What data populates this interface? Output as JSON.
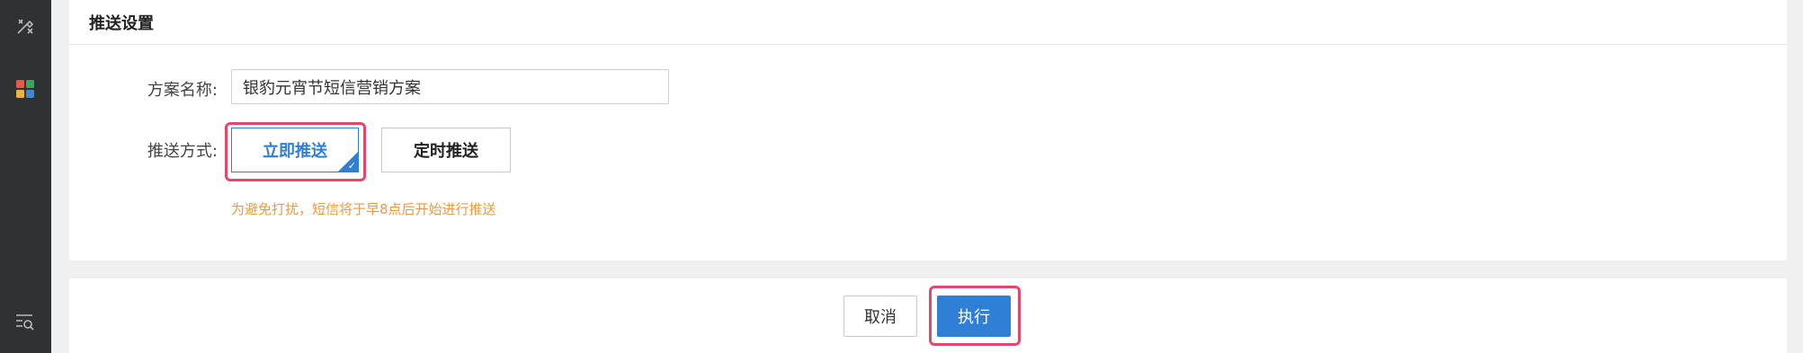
{
  "sidebar": {
    "icons": [
      "tools-icon",
      "apps-grid-icon",
      "list-search-icon"
    ]
  },
  "panel": {
    "title": "推送设置",
    "plan_name_label": "方案名称:",
    "plan_name_value": "银豹元宵节短信营销方案",
    "push_mode_label": "推送方式:",
    "push_now_label": "立即推送",
    "push_scheduled_label": "定时推送",
    "selected_mode": "立即推送",
    "hint": "为避免打扰，短信将于早8点后开始进行推送"
  },
  "footer": {
    "cancel_label": "取消",
    "execute_label": "执行"
  },
  "colors": {
    "accent": "#2f7fd6",
    "highlight": "#e5476a",
    "hint": "#e99a3f",
    "sidebar": "#2f3133"
  }
}
